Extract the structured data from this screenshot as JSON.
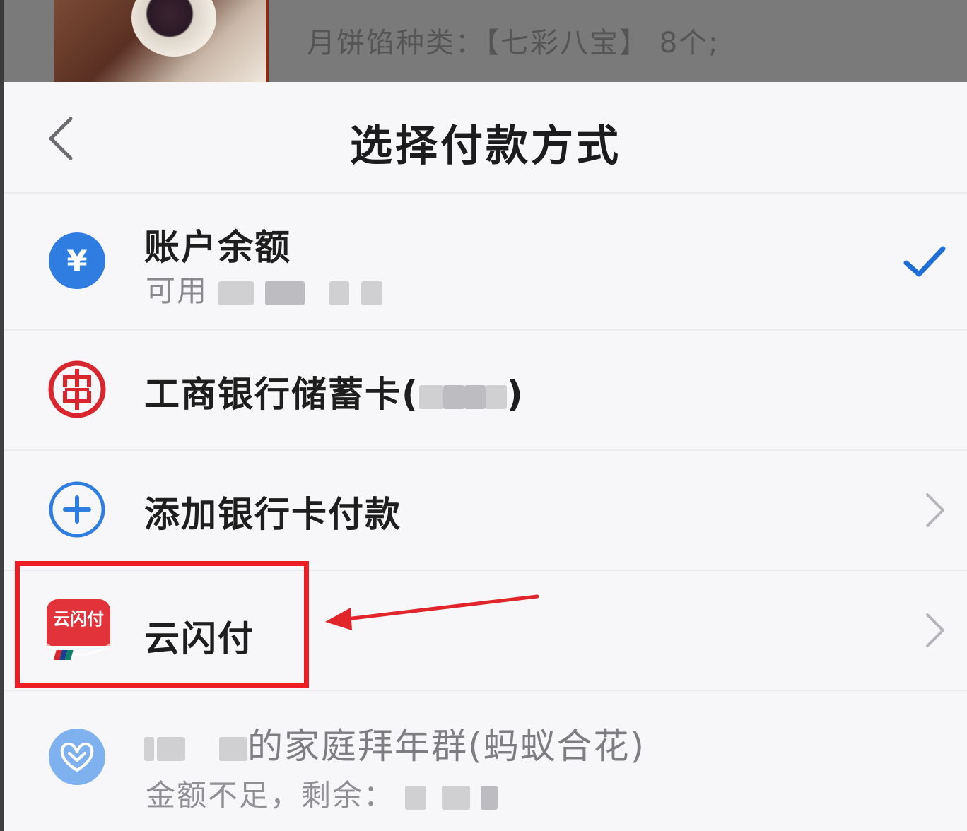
{
  "background": {
    "product_spec": "月饼馅种类：【七彩八宝】 8个;"
  },
  "header": {
    "title": "选择付款方式"
  },
  "methods": [
    {
      "label": "账户余额",
      "sublabel": "可用",
      "selected": true,
      "icon": "yuan-coin-icon"
    },
    {
      "label": "工商银行储蓄卡",
      "suffix_open": "(",
      "suffix_close": ")",
      "icon": "icbc-logo-icon"
    },
    {
      "label": "添加银行卡付款",
      "icon": "plus-circle-icon"
    },
    {
      "label": "云闪付",
      "icon": "unionpay-quickpass-icon",
      "icon_text": "云闪付",
      "highlighted": true
    },
    {
      "label": "的家庭拜年群(蚂蚁合花)",
      "sublabel": "金额不足，剩余：",
      "icon": "ant-flower-icon"
    }
  ],
  "colors": {
    "accent_blue": "#2f7de1",
    "icbc_red": "#d7262e",
    "highlight_red": "#ee1c24",
    "check_blue": "#1f6fd6"
  }
}
